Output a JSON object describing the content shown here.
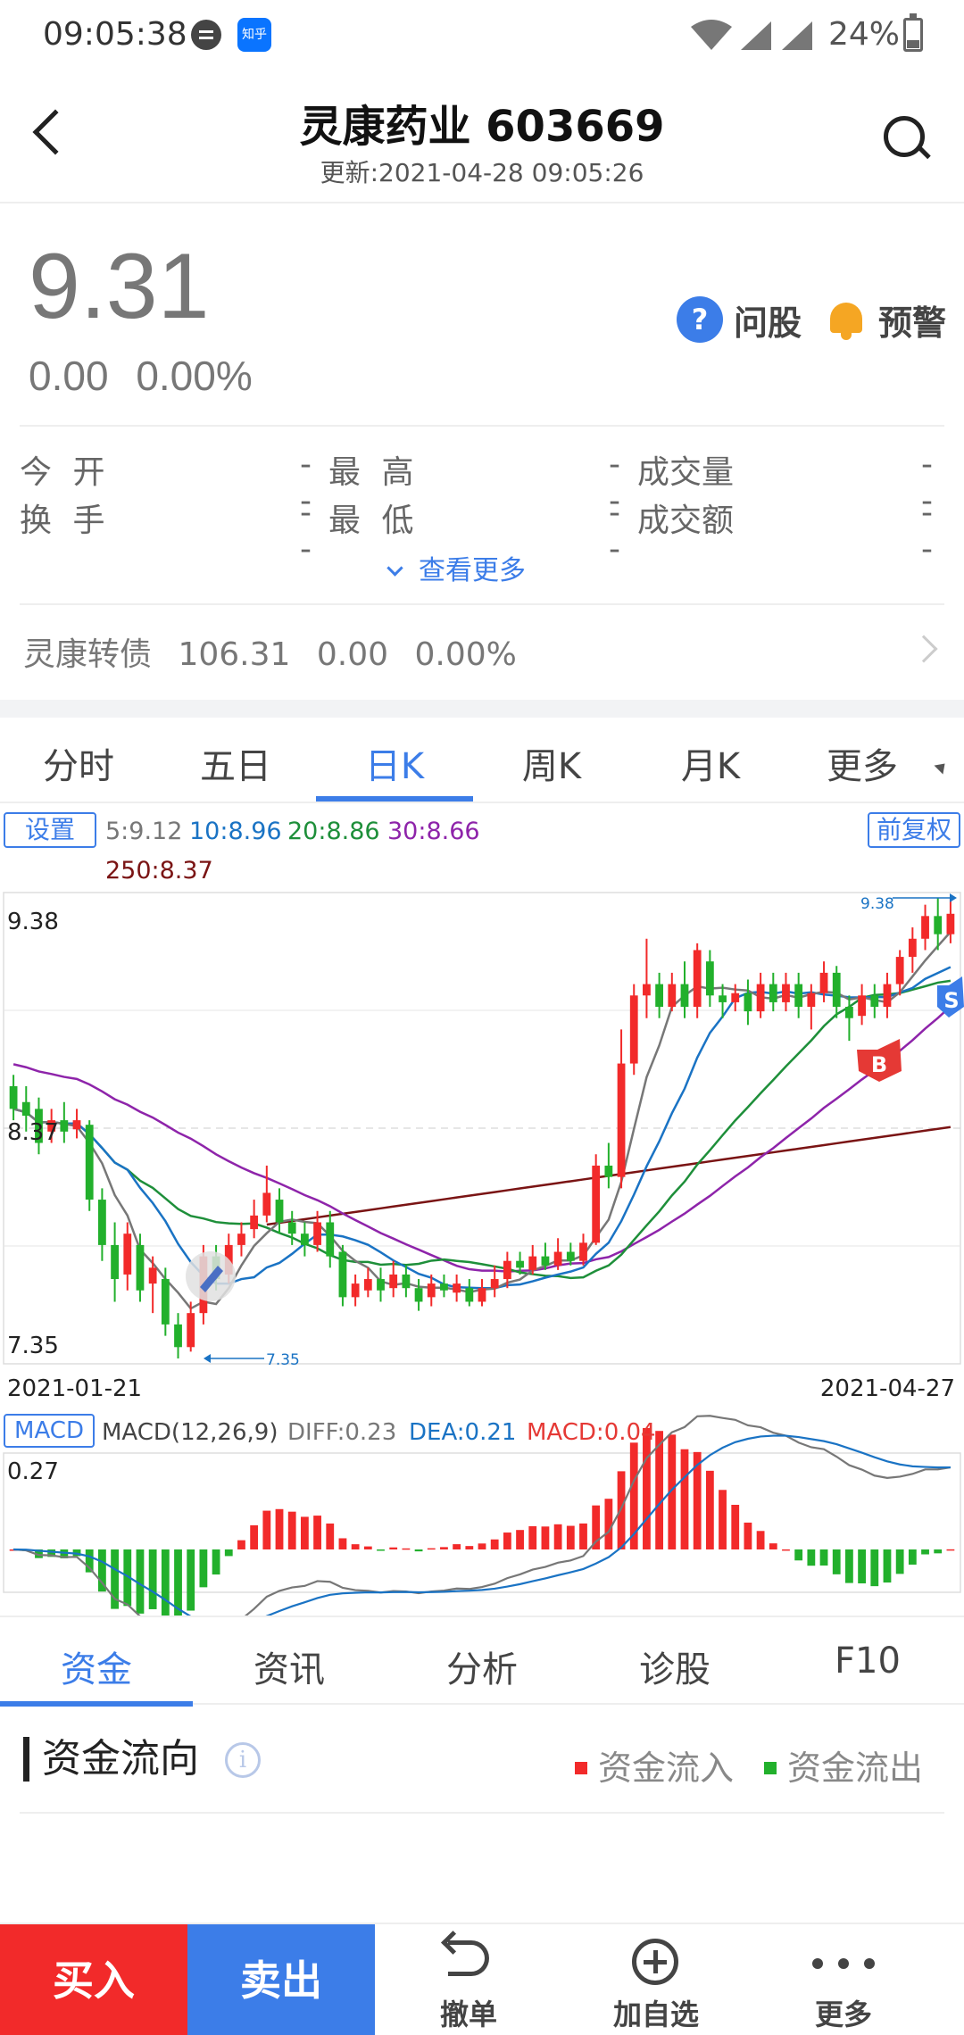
{
  "status": {
    "time": "09:05:38",
    "zhihu": "知乎",
    "battery": "24%"
  },
  "header": {
    "title": "灵康药业 603669",
    "updated": "更新:2021-04-28 09:05:26"
  },
  "quote": {
    "price": "9.31",
    "change": "0.00",
    "change_pct": "0.00%",
    "ask_label": "问股",
    "alert_label": "预警"
  },
  "stats": {
    "rows": [
      [
        {
          "label": "今 开",
          "value": "--"
        },
        {
          "label": "最 高",
          "value": "--"
        },
        {
          "label": "成交量",
          "value": "--"
        }
      ],
      [
        {
          "label": "换 手",
          "value": "--"
        },
        {
          "label": "最 低",
          "value": "--"
        },
        {
          "label": "成交额",
          "value": "--"
        }
      ]
    ],
    "more": "查看更多"
  },
  "bond": {
    "name": "灵康转债",
    "price": "106.31",
    "change": "0.00",
    "pct": "0.00%"
  },
  "chart_tabs": [
    "分时",
    "五日",
    "日K",
    "周K",
    "月K",
    "更多"
  ],
  "chart_tab_active": 2,
  "ma": {
    "settings": "设置",
    "adjust": "前复权",
    "ma5": "5:9.12",
    "ma10": "10:8.96",
    "ma20": "20:8.86",
    "ma30": "30:8.66",
    "ma250": "250:8.37"
  },
  "colors": {
    "up": "#f22a2a",
    "down": "#22b02c",
    "ma5": "#777777",
    "ma10": "#1a73c4",
    "ma20": "#1e8f3a",
    "ma30": "#8e24aa",
    "ma250": "#7a1414",
    "accent": "#3c7de8"
  },
  "kchart": {
    "y_max_label": "9.38",
    "y_mid_label": "8.37",
    "y_min_label": "7.35",
    "high_marker": "9.38",
    "low_marker": "7.35",
    "date_start": "2021-01-21",
    "date_end": "2021-04-27",
    "buy_marker": "B",
    "sell_marker": "S"
  },
  "macd": {
    "button": "MACD",
    "params": "MACD(12,26,9)",
    "diff": "DIFF:0.23",
    "dea": "DEA:0.21",
    "macd": "MACD:0.04",
    "y_label": "0.27"
  },
  "chart_data": [
    {
      "type": "candlestick",
      "x_start": "2021-01-21",
      "x_end": "2021-04-27",
      "ylim": [
        7.35,
        9.38
      ],
      "series": [
        {
          "name": "5",
          "last": 9.12
        },
        {
          "name": "10",
          "last": 8.96
        },
        {
          "name": "20",
          "last": 8.86
        },
        {
          "name": "30",
          "last": 8.66
        },
        {
          "name": "250",
          "last": 8.37
        }
      ],
      "candles": [
        [
          8.55,
          8.45,
          8.6,
          8.4
        ],
        [
          8.48,
          8.42,
          8.55,
          8.35
        ],
        [
          8.45,
          8.3,
          8.5,
          8.25
        ],
        [
          8.35,
          8.4,
          8.45,
          8.3
        ],
        [
          8.4,
          8.35,
          8.48,
          8.3
        ],
        [
          8.36,
          8.4,
          8.45,
          8.32
        ],
        [
          8.38,
          8.05,
          8.4,
          8.0
        ],
        [
          8.05,
          7.85,
          8.1,
          7.78
        ],
        [
          7.85,
          7.7,
          7.95,
          7.6
        ],
        [
          7.72,
          7.9,
          7.95,
          7.65
        ],
        [
          7.85,
          7.65,
          7.9,
          7.6
        ],
        [
          7.68,
          7.75,
          7.8,
          7.55
        ],
        [
          7.7,
          7.5,
          7.75,
          7.45
        ],
        [
          7.5,
          7.4,
          7.55,
          7.35
        ],
        [
          7.4,
          7.55,
          7.6,
          7.38
        ],
        [
          7.55,
          7.8,
          7.85,
          7.5
        ],
        [
          7.8,
          7.7,
          7.85,
          7.65
        ],
        [
          7.72,
          7.85,
          7.9,
          7.68
        ],
        [
          7.85,
          7.9,
          7.95,
          7.8
        ],
        [
          7.92,
          7.98,
          8.05,
          7.88
        ],
        [
          7.98,
          8.08,
          8.2,
          7.95
        ],
        [
          8.05,
          7.95,
          8.1,
          7.9
        ],
        [
          7.95,
          7.9,
          8.0,
          7.85
        ],
        [
          7.9,
          7.85,
          7.95,
          7.8
        ],
        [
          7.85,
          7.95,
          8.0,
          7.82
        ],
        [
          7.95,
          7.8,
          8.0,
          7.75
        ],
        [
          7.82,
          7.62,
          7.85,
          7.58
        ],
        [
          7.62,
          7.68,
          7.72,
          7.58
        ],
        [
          7.65,
          7.7,
          7.75,
          7.62
        ],
        [
          7.7,
          7.65,
          7.75,
          7.6
        ],
        [
          7.66,
          7.72,
          7.78,
          7.62
        ],
        [
          7.72,
          7.66,
          7.76,
          7.62
        ],
        [
          7.66,
          7.6,
          7.7,
          7.56
        ],
        [
          7.62,
          7.68,
          7.72,
          7.58
        ],
        [
          7.68,
          7.65,
          7.72,
          7.62
        ],
        [
          7.64,
          7.68,
          7.72,
          7.6
        ],
        [
          7.66,
          7.6,
          7.7,
          7.58
        ],
        [
          7.6,
          7.66,
          7.7,
          7.58
        ],
        [
          7.66,
          7.7,
          7.76,
          7.62
        ],
        [
          7.7,
          7.78,
          7.82,
          7.66
        ],
        [
          7.78,
          7.75,
          7.82,
          7.72
        ],
        [
          7.74,
          7.8,
          7.85,
          7.72
        ],
        [
          7.8,
          7.76,
          7.86,
          7.74
        ],
        [
          7.76,
          7.82,
          7.88,
          7.74
        ],
        [
          7.82,
          7.78,
          7.86,
          7.76
        ],
        [
          7.78,
          7.86,
          7.9,
          7.76
        ],
        [
          7.86,
          8.2,
          8.25,
          7.85
        ],
        [
          8.2,
          8.15,
          8.3,
          8.1
        ],
        [
          8.15,
          8.65,
          8.8,
          8.1
        ],
        [
          8.65,
          8.95,
          9.0,
          8.6
        ],
        [
          8.95,
          9.0,
          9.2,
          8.85
        ],
        [
          9.0,
          8.9,
          9.05,
          8.85
        ],
        [
          8.9,
          9.0,
          9.05,
          8.88
        ],
        [
          9.0,
          8.9,
          9.1,
          8.85
        ],
        [
          8.9,
          9.15,
          9.18,
          8.85
        ],
        [
          9.1,
          8.95,
          9.15,
          8.9
        ],
        [
          8.95,
          8.92,
          9.0,
          8.85
        ],
        [
          8.92,
          8.96,
          9.0,
          8.88
        ],
        [
          8.96,
          8.88,
          9.02,
          8.82
        ],
        [
          8.88,
          9.0,
          9.05,
          8.85
        ],
        [
          9.0,
          8.92,
          9.05,
          8.88
        ],
        [
          8.92,
          9.0,
          9.05,
          8.88
        ],
        [
          9.0,
          8.9,
          9.05,
          8.85
        ],
        [
          8.9,
          8.96,
          9.0,
          8.8
        ],
        [
          8.96,
          9.05,
          9.1,
          8.92
        ],
        [
          9.05,
          8.9,
          9.08,
          8.85
        ],
        [
          8.9,
          8.85,
          8.95,
          8.75
        ],
        [
          8.86,
          8.95,
          9.0,
          8.82
        ],
        [
          8.95,
          8.9,
          9.0,
          8.85
        ],
        [
          8.9,
          9.0,
          9.05,
          8.85
        ],
        [
          9.0,
          9.12,
          9.15,
          8.95
        ],
        [
          9.12,
          9.2,
          9.25,
          9.05
        ],
        [
          9.2,
          9.3,
          9.35,
          9.15
        ],
        [
          9.3,
          9.22,
          9.38,
          9.15
        ],
        [
          9.22,
          9.31,
          9.38,
          9.18
        ]
      ]
    },
    {
      "type": "bar",
      "title": "MACD(12,26,9)",
      "ylim": [
        -0.12,
        0.27
      ],
      "series": [
        {
          "name": "DIFF",
          "last": 0.23
        },
        {
          "name": "DEA",
          "last": 0.21
        },
        {
          "name": "MACD",
          "last": 0.04
        }
      ]
    }
  ],
  "feature_tabs": [
    "资金",
    "资讯",
    "分析",
    "诊股",
    "F10"
  ],
  "feature_tab_active": 0,
  "flow": {
    "title": "资金流向",
    "info": "i",
    "in_label": "资金流入",
    "out_label": "资金流出"
  },
  "bottom": {
    "buy": "买入",
    "sell": "卖出",
    "cancel": "撤单",
    "watch": "加自选",
    "more": "更多"
  }
}
